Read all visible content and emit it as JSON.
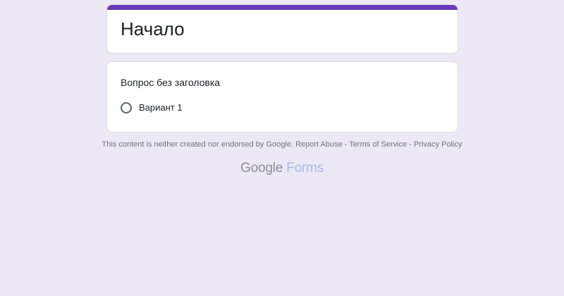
{
  "form": {
    "title": "Начало",
    "accent_color": "#673ab7",
    "background_color": "#ece8f5"
  },
  "question": {
    "title": "Вопрос без заголовка",
    "options": [
      {
        "label": "Вариант 1",
        "type": "radio",
        "selected": false
      }
    ]
  },
  "footer": {
    "disclaimer": "This content is neither created nor endorsed by Google.",
    "report_abuse": "Report Abuse",
    "sep1": " - ",
    "terms": "Terms of Service",
    "sep2": " - ",
    "privacy": "Privacy Policy"
  },
  "brand": {
    "google": "Google",
    "forms": "Forms"
  }
}
